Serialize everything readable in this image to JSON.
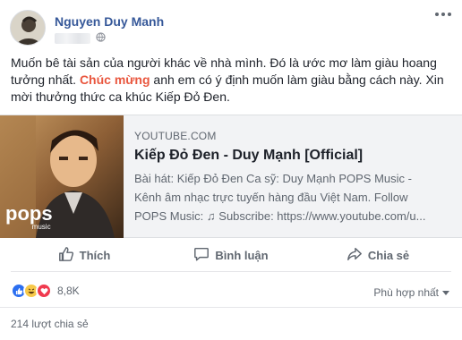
{
  "post": {
    "author": "Nguyen Duy Manh",
    "text_before": "Muốn bê tài sản của người khác về nhà mình. Đó là ước mơ làm giàu hoang tưởng nhất. ",
    "text_highlight": "Chúc mừng",
    "text_after": " anh em có ý định muốn làm giàu bằng cách này. Xin mời thưởng thức ca khúc Kiếp Đỏ Đen.",
    "privacy_icon": "globe-icon",
    "menu_icon": "more-horizontal-icon"
  },
  "link": {
    "domain": "YOUTUBE.COM",
    "title": "Kiếp Đỏ Đen - Duy Mạnh [Official]",
    "desc_line1": "Bài hát: Kiếp Đỏ Đen Ca sỹ: Duy Mạnh POPS Music -",
    "desc_line2": "Kênh âm nhạc trực tuyến hàng đầu Việt Nam. Follow",
    "desc_line3": "POPS Music: ♫ Subscribe: https://www.youtube.com/u...",
    "thumb_logo": "pops",
    "thumb_logo_sub": "music"
  },
  "actions": {
    "like": "Thích",
    "comment": "Bình luận",
    "share": "Chia sẻ"
  },
  "reactions": {
    "count": "8,8K",
    "types": [
      "like",
      "haha",
      "love"
    ]
  },
  "sort": {
    "label": "Phù hợp nhất"
  },
  "shares": {
    "label": "214 lượt chia sẻ"
  },
  "colors": {
    "link_blue": "#365899",
    "highlight": "#e9573f",
    "secondary_text": "#606770",
    "like_blue": "#2c6ff0",
    "love_red": "#f03a4f",
    "haha_yellow": "#f7c94a"
  }
}
